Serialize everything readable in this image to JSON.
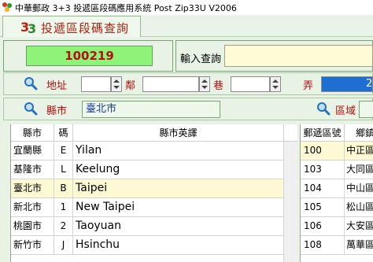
{
  "window": {
    "title": "中華郵政 3+3 投遞區段碼應用系統    Post Zip33U V2006"
  },
  "tab": {
    "label": "投遞區段碼查詢"
  },
  "result": {
    "zipcode": "100219"
  },
  "query": {
    "label": "輸入查詢",
    "value": ""
  },
  "address": {
    "addr_label": "地址",
    "lin_label": "鄰",
    "alley_label": "巷",
    "lane_label": "弄",
    "lane_value": "2"
  },
  "city": {
    "label": "縣市",
    "value": "臺北市",
    "district_label": "區域"
  },
  "city_table": {
    "headers": [
      "縣市",
      "碼",
      "縣市英譯"
    ],
    "rows": [
      {
        "city": "宜蘭縣",
        "code": "E",
        "en": "Yilan",
        "selected": false
      },
      {
        "city": "基隆市",
        "code": "L",
        "en": "Keelung",
        "selected": false
      },
      {
        "city": "臺北市",
        "code": "B",
        "en": "Taipei",
        "selected": true
      },
      {
        "city": "新北市",
        "code": "1",
        "en": "New Taipei",
        "selected": false
      },
      {
        "city": "桃園市",
        "code": "2",
        "en": "Taoyuan",
        "selected": false
      },
      {
        "city": "新竹市",
        "code": "J",
        "en": "Hsinchu",
        "selected": false
      }
    ]
  },
  "district_table": {
    "headers": [
      "郵遞區號",
      "鄉鎮"
    ],
    "rows": [
      {
        "zip": "100",
        "name": "中正區",
        "selected": true
      },
      {
        "zip": "103",
        "name": "大同區",
        "selected": false
      },
      {
        "zip": "104",
        "name": "中山區",
        "selected": false
      },
      {
        "zip": "105",
        "name": "松山區",
        "selected": false
      },
      {
        "zip": "106",
        "name": "大安區",
        "selected": false
      },
      {
        "zip": "108",
        "name": "萬華區",
        "selected": false
      }
    ]
  },
  "colors": {
    "accent_red": "#b01010",
    "zip_box_green": "#8ff37a",
    "selected_row": "#fdf9d3",
    "panel_bg": "#e8f3e6"
  },
  "icons": [
    "app-logo-33",
    "magnifier-icon"
  ]
}
